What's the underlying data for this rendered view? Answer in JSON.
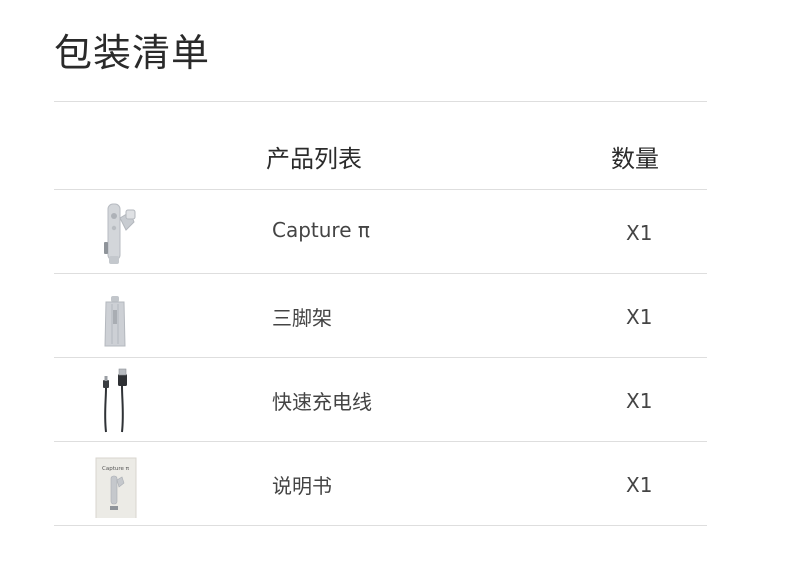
{
  "title": "包装清单",
  "table": {
    "headers": {
      "product": "产品列表",
      "quantity": "数量"
    },
    "rows": [
      {
        "name": "Capture π",
        "qty": "X1",
        "icon": "gimbal-icon"
      },
      {
        "name": "三脚架",
        "qty": "X1",
        "icon": "tripod-icon"
      },
      {
        "name": "快速充电线",
        "qty": "X1",
        "icon": "usb-cable-icon"
      },
      {
        "name": "说明书",
        "qty": "X1",
        "icon": "manual-icon"
      }
    ]
  },
  "manual_cover_text": "Capture π",
  "colors": {
    "divider": "#dedede",
    "text": "#444444",
    "product_silver": "#c9ccd1"
  }
}
